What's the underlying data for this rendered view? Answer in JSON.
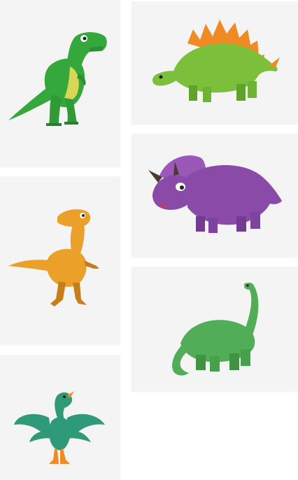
{
  "colors": {
    "card_background": "#f4f4f4",
    "trex_green": "#35a83c",
    "trex_belly": "#d8d657",
    "stego_green": "#7cbf3a",
    "stego_plates": "#f08a24",
    "triceratops_purple": "#8a4aa8",
    "raptor_orange": "#eba02a",
    "bronto_green": "#52ad58",
    "archaeopteryx_teal": "#2f9a78"
  },
  "stickers": [
    {
      "name": "tyrannosaurus",
      "icon": "trex-icon"
    },
    {
      "name": "stegosaurus",
      "icon": "stegosaurus-icon"
    },
    {
      "name": "triceratops",
      "icon": "triceratops-icon"
    },
    {
      "name": "velociraptor",
      "icon": "raptor-icon"
    },
    {
      "name": "brontosaurus",
      "icon": "brontosaurus-icon"
    },
    {
      "name": "archaeopteryx",
      "icon": "archaeopteryx-icon"
    }
  ]
}
